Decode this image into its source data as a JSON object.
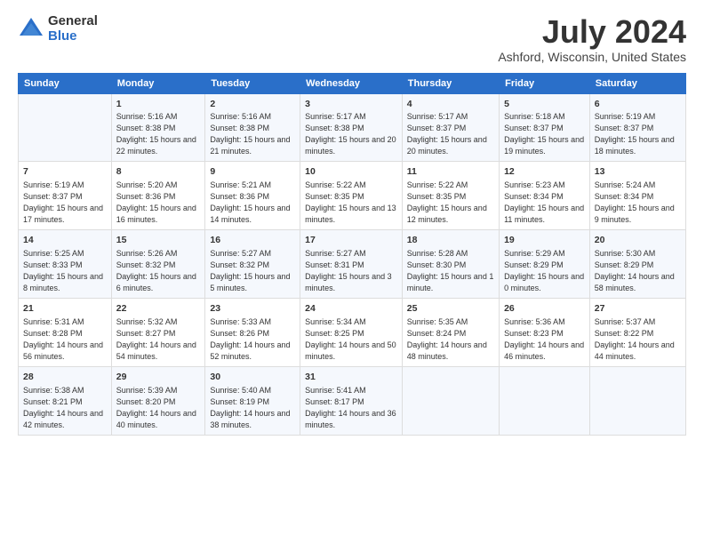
{
  "logo": {
    "general": "General",
    "blue": "Blue"
  },
  "header": {
    "title": "July 2024",
    "subtitle": "Ashford, Wisconsin, United States"
  },
  "columns": [
    "Sunday",
    "Monday",
    "Tuesday",
    "Wednesday",
    "Thursday",
    "Friday",
    "Saturday"
  ],
  "weeks": [
    [
      {
        "day": "",
        "sunrise": "",
        "sunset": "",
        "daylight": ""
      },
      {
        "day": "1",
        "sunrise": "Sunrise: 5:16 AM",
        "sunset": "Sunset: 8:38 PM",
        "daylight": "Daylight: 15 hours and 22 minutes."
      },
      {
        "day": "2",
        "sunrise": "Sunrise: 5:16 AM",
        "sunset": "Sunset: 8:38 PM",
        "daylight": "Daylight: 15 hours and 21 minutes."
      },
      {
        "day": "3",
        "sunrise": "Sunrise: 5:17 AM",
        "sunset": "Sunset: 8:38 PM",
        "daylight": "Daylight: 15 hours and 20 minutes."
      },
      {
        "day": "4",
        "sunrise": "Sunrise: 5:17 AM",
        "sunset": "Sunset: 8:37 PM",
        "daylight": "Daylight: 15 hours and 20 minutes."
      },
      {
        "day": "5",
        "sunrise": "Sunrise: 5:18 AM",
        "sunset": "Sunset: 8:37 PM",
        "daylight": "Daylight: 15 hours and 19 minutes."
      },
      {
        "day": "6",
        "sunrise": "Sunrise: 5:19 AM",
        "sunset": "Sunset: 8:37 PM",
        "daylight": "Daylight: 15 hours and 18 minutes."
      }
    ],
    [
      {
        "day": "7",
        "sunrise": "Sunrise: 5:19 AM",
        "sunset": "Sunset: 8:37 PM",
        "daylight": "Daylight: 15 hours and 17 minutes."
      },
      {
        "day": "8",
        "sunrise": "Sunrise: 5:20 AM",
        "sunset": "Sunset: 8:36 PM",
        "daylight": "Daylight: 15 hours and 16 minutes."
      },
      {
        "day": "9",
        "sunrise": "Sunrise: 5:21 AM",
        "sunset": "Sunset: 8:36 PM",
        "daylight": "Daylight: 15 hours and 14 minutes."
      },
      {
        "day": "10",
        "sunrise": "Sunrise: 5:22 AM",
        "sunset": "Sunset: 8:35 PM",
        "daylight": "Daylight: 15 hours and 13 minutes."
      },
      {
        "day": "11",
        "sunrise": "Sunrise: 5:22 AM",
        "sunset": "Sunset: 8:35 PM",
        "daylight": "Daylight: 15 hours and 12 minutes."
      },
      {
        "day": "12",
        "sunrise": "Sunrise: 5:23 AM",
        "sunset": "Sunset: 8:34 PM",
        "daylight": "Daylight: 15 hours and 11 minutes."
      },
      {
        "day": "13",
        "sunrise": "Sunrise: 5:24 AM",
        "sunset": "Sunset: 8:34 PM",
        "daylight": "Daylight: 15 hours and 9 minutes."
      }
    ],
    [
      {
        "day": "14",
        "sunrise": "Sunrise: 5:25 AM",
        "sunset": "Sunset: 8:33 PM",
        "daylight": "Daylight: 15 hours and 8 minutes."
      },
      {
        "day": "15",
        "sunrise": "Sunrise: 5:26 AM",
        "sunset": "Sunset: 8:32 PM",
        "daylight": "Daylight: 15 hours and 6 minutes."
      },
      {
        "day": "16",
        "sunrise": "Sunrise: 5:27 AM",
        "sunset": "Sunset: 8:32 PM",
        "daylight": "Daylight: 15 hours and 5 minutes."
      },
      {
        "day": "17",
        "sunrise": "Sunrise: 5:27 AM",
        "sunset": "Sunset: 8:31 PM",
        "daylight": "Daylight: 15 hours and 3 minutes."
      },
      {
        "day": "18",
        "sunrise": "Sunrise: 5:28 AM",
        "sunset": "Sunset: 8:30 PM",
        "daylight": "Daylight: 15 hours and 1 minute."
      },
      {
        "day": "19",
        "sunrise": "Sunrise: 5:29 AM",
        "sunset": "Sunset: 8:29 PM",
        "daylight": "Daylight: 15 hours and 0 minutes."
      },
      {
        "day": "20",
        "sunrise": "Sunrise: 5:30 AM",
        "sunset": "Sunset: 8:29 PM",
        "daylight": "Daylight: 14 hours and 58 minutes."
      }
    ],
    [
      {
        "day": "21",
        "sunrise": "Sunrise: 5:31 AM",
        "sunset": "Sunset: 8:28 PM",
        "daylight": "Daylight: 14 hours and 56 minutes."
      },
      {
        "day": "22",
        "sunrise": "Sunrise: 5:32 AM",
        "sunset": "Sunset: 8:27 PM",
        "daylight": "Daylight: 14 hours and 54 minutes."
      },
      {
        "day": "23",
        "sunrise": "Sunrise: 5:33 AM",
        "sunset": "Sunset: 8:26 PM",
        "daylight": "Daylight: 14 hours and 52 minutes."
      },
      {
        "day": "24",
        "sunrise": "Sunrise: 5:34 AM",
        "sunset": "Sunset: 8:25 PM",
        "daylight": "Daylight: 14 hours and 50 minutes."
      },
      {
        "day": "25",
        "sunrise": "Sunrise: 5:35 AM",
        "sunset": "Sunset: 8:24 PM",
        "daylight": "Daylight: 14 hours and 48 minutes."
      },
      {
        "day": "26",
        "sunrise": "Sunrise: 5:36 AM",
        "sunset": "Sunset: 8:23 PM",
        "daylight": "Daylight: 14 hours and 46 minutes."
      },
      {
        "day": "27",
        "sunrise": "Sunrise: 5:37 AM",
        "sunset": "Sunset: 8:22 PM",
        "daylight": "Daylight: 14 hours and 44 minutes."
      }
    ],
    [
      {
        "day": "28",
        "sunrise": "Sunrise: 5:38 AM",
        "sunset": "Sunset: 8:21 PM",
        "daylight": "Daylight: 14 hours and 42 minutes."
      },
      {
        "day": "29",
        "sunrise": "Sunrise: 5:39 AM",
        "sunset": "Sunset: 8:20 PM",
        "daylight": "Daylight: 14 hours and 40 minutes."
      },
      {
        "day": "30",
        "sunrise": "Sunrise: 5:40 AM",
        "sunset": "Sunset: 8:19 PM",
        "daylight": "Daylight: 14 hours and 38 minutes."
      },
      {
        "day": "31",
        "sunrise": "Sunrise: 5:41 AM",
        "sunset": "Sunset: 8:17 PM",
        "daylight": "Daylight: 14 hours and 36 minutes."
      },
      {
        "day": "",
        "sunrise": "",
        "sunset": "",
        "daylight": ""
      },
      {
        "day": "",
        "sunrise": "",
        "sunset": "",
        "daylight": ""
      },
      {
        "day": "",
        "sunrise": "",
        "sunset": "",
        "daylight": ""
      }
    ]
  ]
}
